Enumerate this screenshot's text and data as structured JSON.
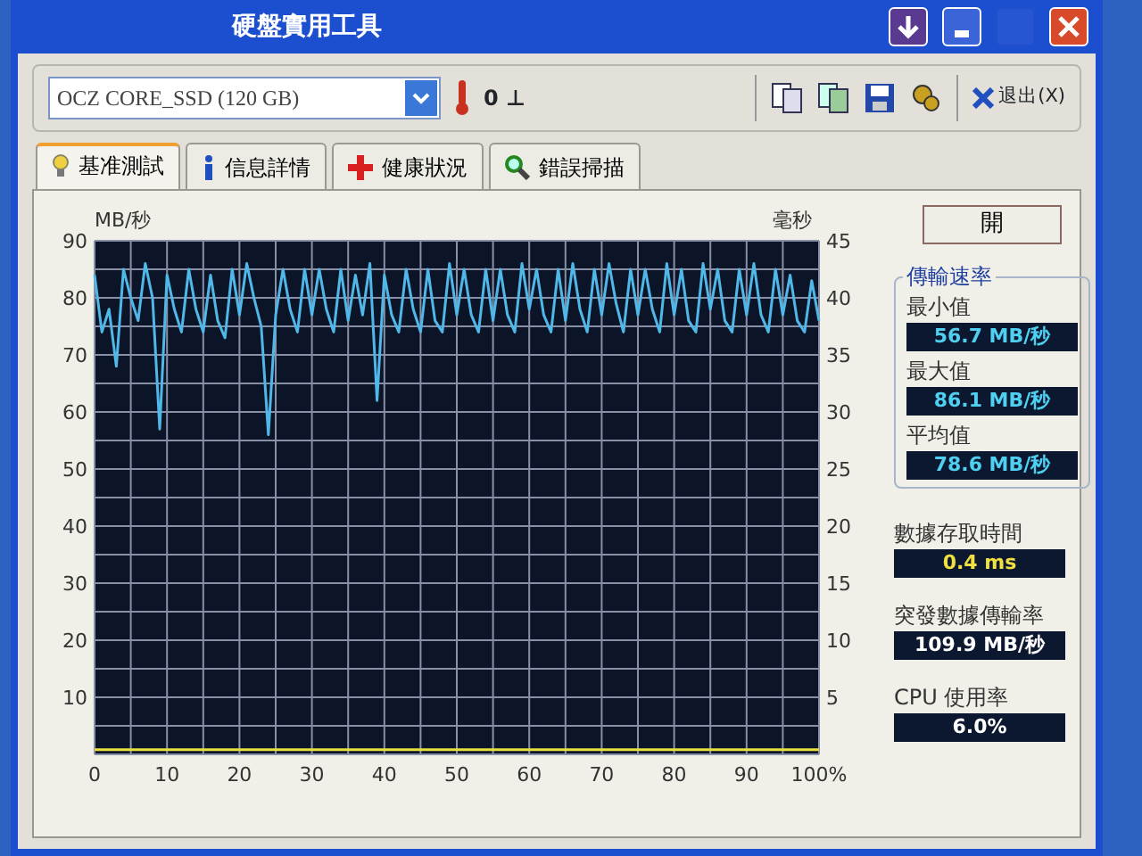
{
  "window": {
    "title": "硬盤實用工具",
    "buttons": [
      {
        "kind": "download"
      },
      {
        "kind": "minimize"
      },
      {
        "kind": "maximize",
        "disabled": true
      },
      {
        "kind": "close"
      }
    ]
  },
  "toolbar": {
    "drive": "OCZ CORE_SSD (120 GB)",
    "temperature": "0 ⊥",
    "exit": "退出(X)"
  },
  "tabs": [
    {
      "label": "基准測試",
      "selected": true
    },
    {
      "label": "信息詳情",
      "selected": false
    },
    {
      "label": "健康狀況",
      "selected": false
    },
    {
      "label": "錯誤掃描",
      "selected": false
    }
  ],
  "start_button": "開",
  "transfer_rate": {
    "title": "傳輸速率",
    "items": [
      {
        "label": "最小值",
        "value": "56.7 MB/秒"
      },
      {
        "label": "最大值",
        "value": "86.1 MB/秒"
      },
      {
        "label": "平均值",
        "value": "78.6 MB/秒"
      }
    ]
  },
  "stats": [
    {
      "label": "數據存取時間",
      "value": "0.4 ms"
    },
    {
      "label": "突發數據傳輸率",
      "value": "109.9 MB/秒"
    },
    {
      "label": "CPU 使用率",
      "value": "6.0%"
    }
  ],
  "chart_data": {
    "type": "line",
    "grid": true,
    "ylabel": "MB/秒",
    "y2label": "毫秒",
    "xlim": [
      0,
      100
    ],
    "ylim": [
      0,
      90
    ],
    "y2lim": [
      0,
      45
    ],
    "x": [
      0,
      1,
      2,
      3,
      4,
      5,
      6,
      7,
      8,
      9,
      10,
      11,
      12,
      13,
      14,
      15,
      16,
      17,
      18,
      19,
      20,
      21,
      22,
      23,
      24,
      25,
      26,
      27,
      28,
      29,
      30,
      31,
      32,
      33,
      34,
      35,
      36,
      37,
      38,
      39,
      40,
      41,
      42,
      43,
      44,
      45,
      46,
      47,
      48,
      49,
      50,
      51,
      52,
      53,
      54,
      55,
      56,
      57,
      58,
      59,
      60,
      61,
      62,
      63,
      64,
      65,
      66,
      67,
      68,
      69,
      70,
      71,
      72,
      73,
      74,
      75,
      76,
      77,
      78,
      79,
      80,
      81,
      82,
      83,
      84,
      85,
      86,
      87,
      88,
      89,
      90,
      91,
      92,
      93,
      94,
      95,
      96,
      97,
      98,
      99,
      100
    ],
    "xticks": [
      0,
      10,
      20,
      30,
      40,
      50,
      60,
      70,
      80,
      90,
      {
        "value": 100,
        "label": "100%"
      }
    ],
    "yticks": [
      10,
      20,
      30,
      40,
      50,
      60,
      70,
      80,
      90
    ],
    "y2ticks": [
      5,
      10,
      15,
      20,
      25,
      30,
      35,
      40,
      45
    ],
    "series": [
      {
        "color": "#4fb8e8",
        "values": [
          84,
          74,
          78,
          68,
          85,
          80,
          76,
          86,
          80,
          57,
          84,
          78,
          74,
          85,
          78,
          74,
          84,
          76,
          73,
          85,
          77,
          86,
          80,
          75,
          56,
          77,
          85,
          78,
          74,
          85,
          77,
          85,
          78,
          74,
          85,
          76,
          84,
          77,
          86,
          62,
          84,
          77,
          74,
          85,
          78,
          74,
          85,
          76,
          74,
          86,
          77,
          85,
          77,
          74,
          85,
          76,
          85,
          77,
          74,
          86,
          78,
          85,
          77,
          74,
          85,
          76,
          86,
          78,
          74,
          85,
          77,
          86,
          79,
          74,
          85,
          77,
          85,
          78,
          74,
          86,
          77,
          85,
          76,
          74,
          86,
          78,
          85,
          76,
          74,
          85,
          77,
          86,
          77,
          74,
          85,
          77,
          84,
          76,
          74,
          83,
          76
        ]
      },
      {
        "color": "#e8e040",
        "axis": "y2",
        "values": [
          0.4,
          0.4,
          0.4,
          0.4,
          0.4,
          0.4,
          0.4,
          0.4,
          0.4,
          0.4,
          0.4,
          0.4,
          0.4,
          0.4,
          0.4,
          0.4,
          0.4,
          0.4,
          0.4,
          0.4,
          0.4,
          0.4,
          0.4,
          0.4,
          0.4,
          0.4,
          0.4,
          0.4,
          0.4,
          0.4,
          0.4,
          0.4,
          0.4,
          0.4,
          0.4,
          0.4,
          0.4,
          0.4,
          0.4,
          0.4,
          0.4,
          0.4,
          0.4,
          0.4,
          0.4,
          0.4,
          0.4,
          0.4,
          0.4,
          0.4,
          0.4,
          0.4,
          0.4,
          0.4,
          0.4,
          0.4,
          0.4,
          0.4,
          0.4,
          0.4,
          0.4,
          0.4,
          0.4,
          0.4,
          0.4,
          0.4,
          0.4,
          0.4,
          0.4,
          0.4,
          0.4,
          0.4,
          0.4,
          0.4,
          0.4,
          0.4,
          0.4,
          0.4,
          0.4,
          0.4,
          0.4,
          0.4,
          0.4,
          0.4,
          0.4,
          0.4,
          0.4,
          0.4,
          0.4,
          0.4,
          0.4,
          0.4,
          0.4,
          0.4,
          0.4,
          0.4,
          0.4,
          0.4,
          0.4,
          0.4,
          0.4
        ]
      }
    ]
  }
}
